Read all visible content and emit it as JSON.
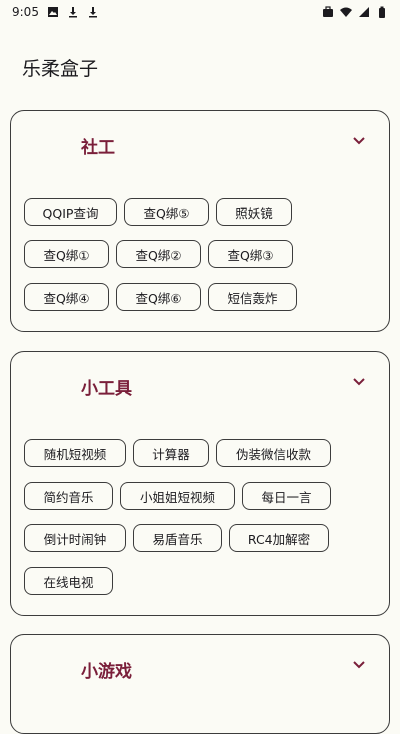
{
  "status": {
    "time": "9:05",
    "left_icons": [
      "image-icon",
      "download-icon",
      "download-icon"
    ],
    "right_icons": [
      "briefcase-icon",
      "wifi-icon",
      "signal-icon",
      "battery-icon"
    ]
  },
  "app": {
    "title": "乐柔盒子"
  },
  "sections": [
    {
      "title": "社工",
      "buttons": [
        "QQIP查询",
        "查Q绑⑤",
        "照妖镜",
        "查Q绑①",
        "查Q绑②",
        "查Q绑③",
        "查Q绑④",
        "查Q绑⑥",
        "短信轰炸"
      ]
    },
    {
      "title": "小工具",
      "buttons": [
        "随机短视频",
        "计算器",
        "伪装微信收款",
        "简约音乐",
        "小姐姐短视频",
        "每日一言",
        "倒计时闹钟",
        "易盾音乐",
        "RC4加解密",
        "在线电视"
      ]
    },
    {
      "title": "小游戏",
      "buttons": []
    }
  ],
  "colors": {
    "accent": "#7a1f3a",
    "background": "#fbfbf5",
    "border": "#3c3c3c"
  }
}
